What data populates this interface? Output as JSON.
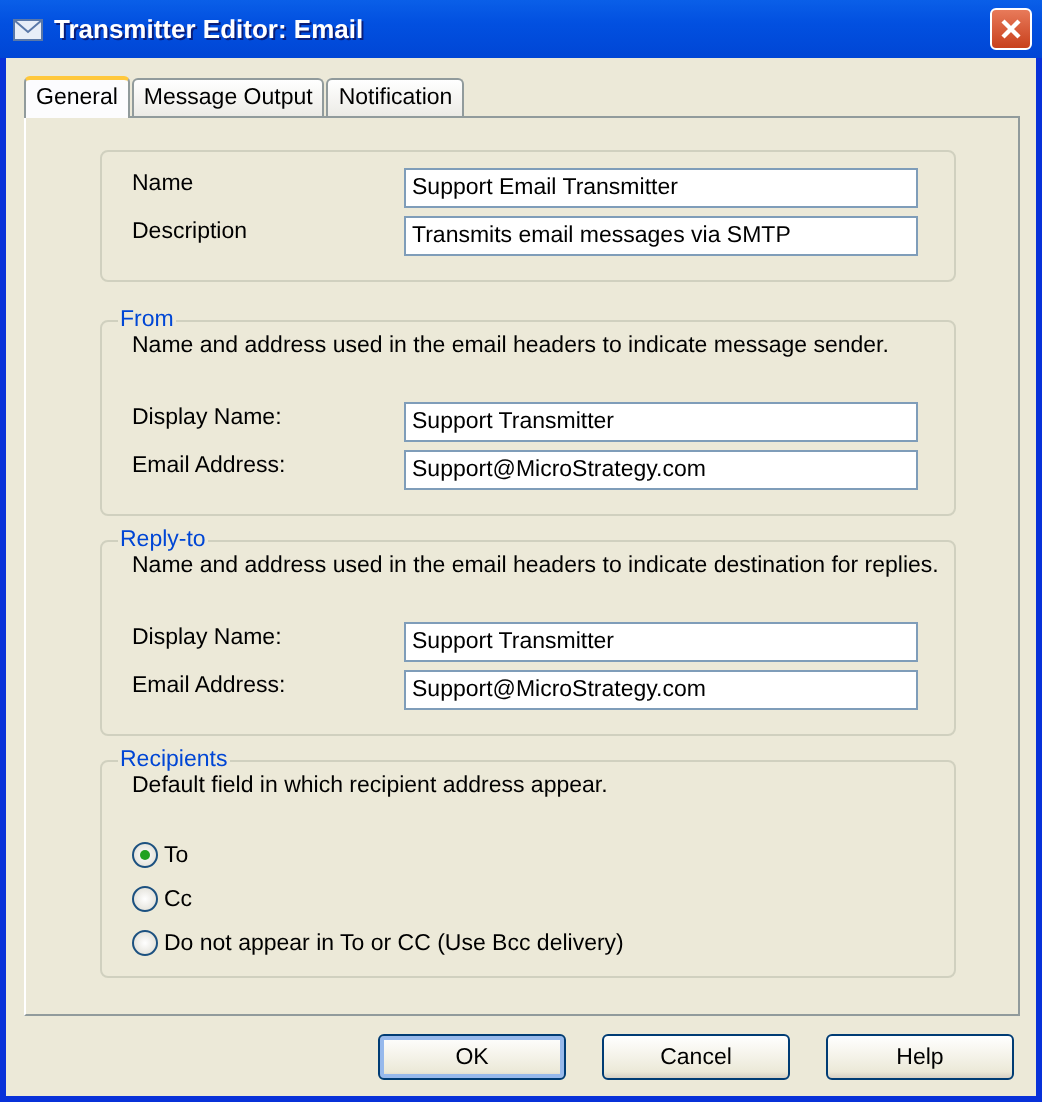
{
  "window": {
    "title": "Transmitter Editor: Email"
  },
  "tabs": [
    {
      "label": "General",
      "selected": true
    },
    {
      "label": "Message Output",
      "selected": false
    },
    {
      "label": "Notification",
      "selected": false
    }
  ],
  "groups": [
    {
      "fields": [
        {
          "label": "Name",
          "value": "Support Email Transmitter"
        },
        {
          "label": "Description",
          "value": "Transmits email messages via SMTP"
        }
      ]
    },
    {
      "title": "From",
      "description": "Name and address used in the email headers to indicate message sender.",
      "fields": [
        {
          "label": "Display Name:",
          "value": "Support Transmitter"
        },
        {
          "label": "Email Address:",
          "value": "Support@MicroStrategy.com"
        }
      ]
    },
    {
      "title": "Reply-to",
      "description": "Name and address used in the email headers to indicate destination for replies.",
      "fields": [
        {
          "label": "Display Name:",
          "value": "Support Transmitter"
        },
        {
          "label": "Email Address:",
          "value": "Support@MicroStrategy.com"
        }
      ]
    }
  ],
  "recipients": {
    "title": "Recipients",
    "description": "Default field in which recipient address appear.",
    "options": [
      {
        "label": "To",
        "selected": true
      },
      {
        "label": "Cc",
        "selected": false
      },
      {
        "label": "Do not appear in To or CC (Use Bcc delivery)",
        "selected": false
      }
    ]
  },
  "buttons": [
    {
      "label": "OK",
      "default": true
    },
    {
      "label": "Cancel",
      "default": false
    },
    {
      "label": "Help",
      "default": false
    }
  ]
}
